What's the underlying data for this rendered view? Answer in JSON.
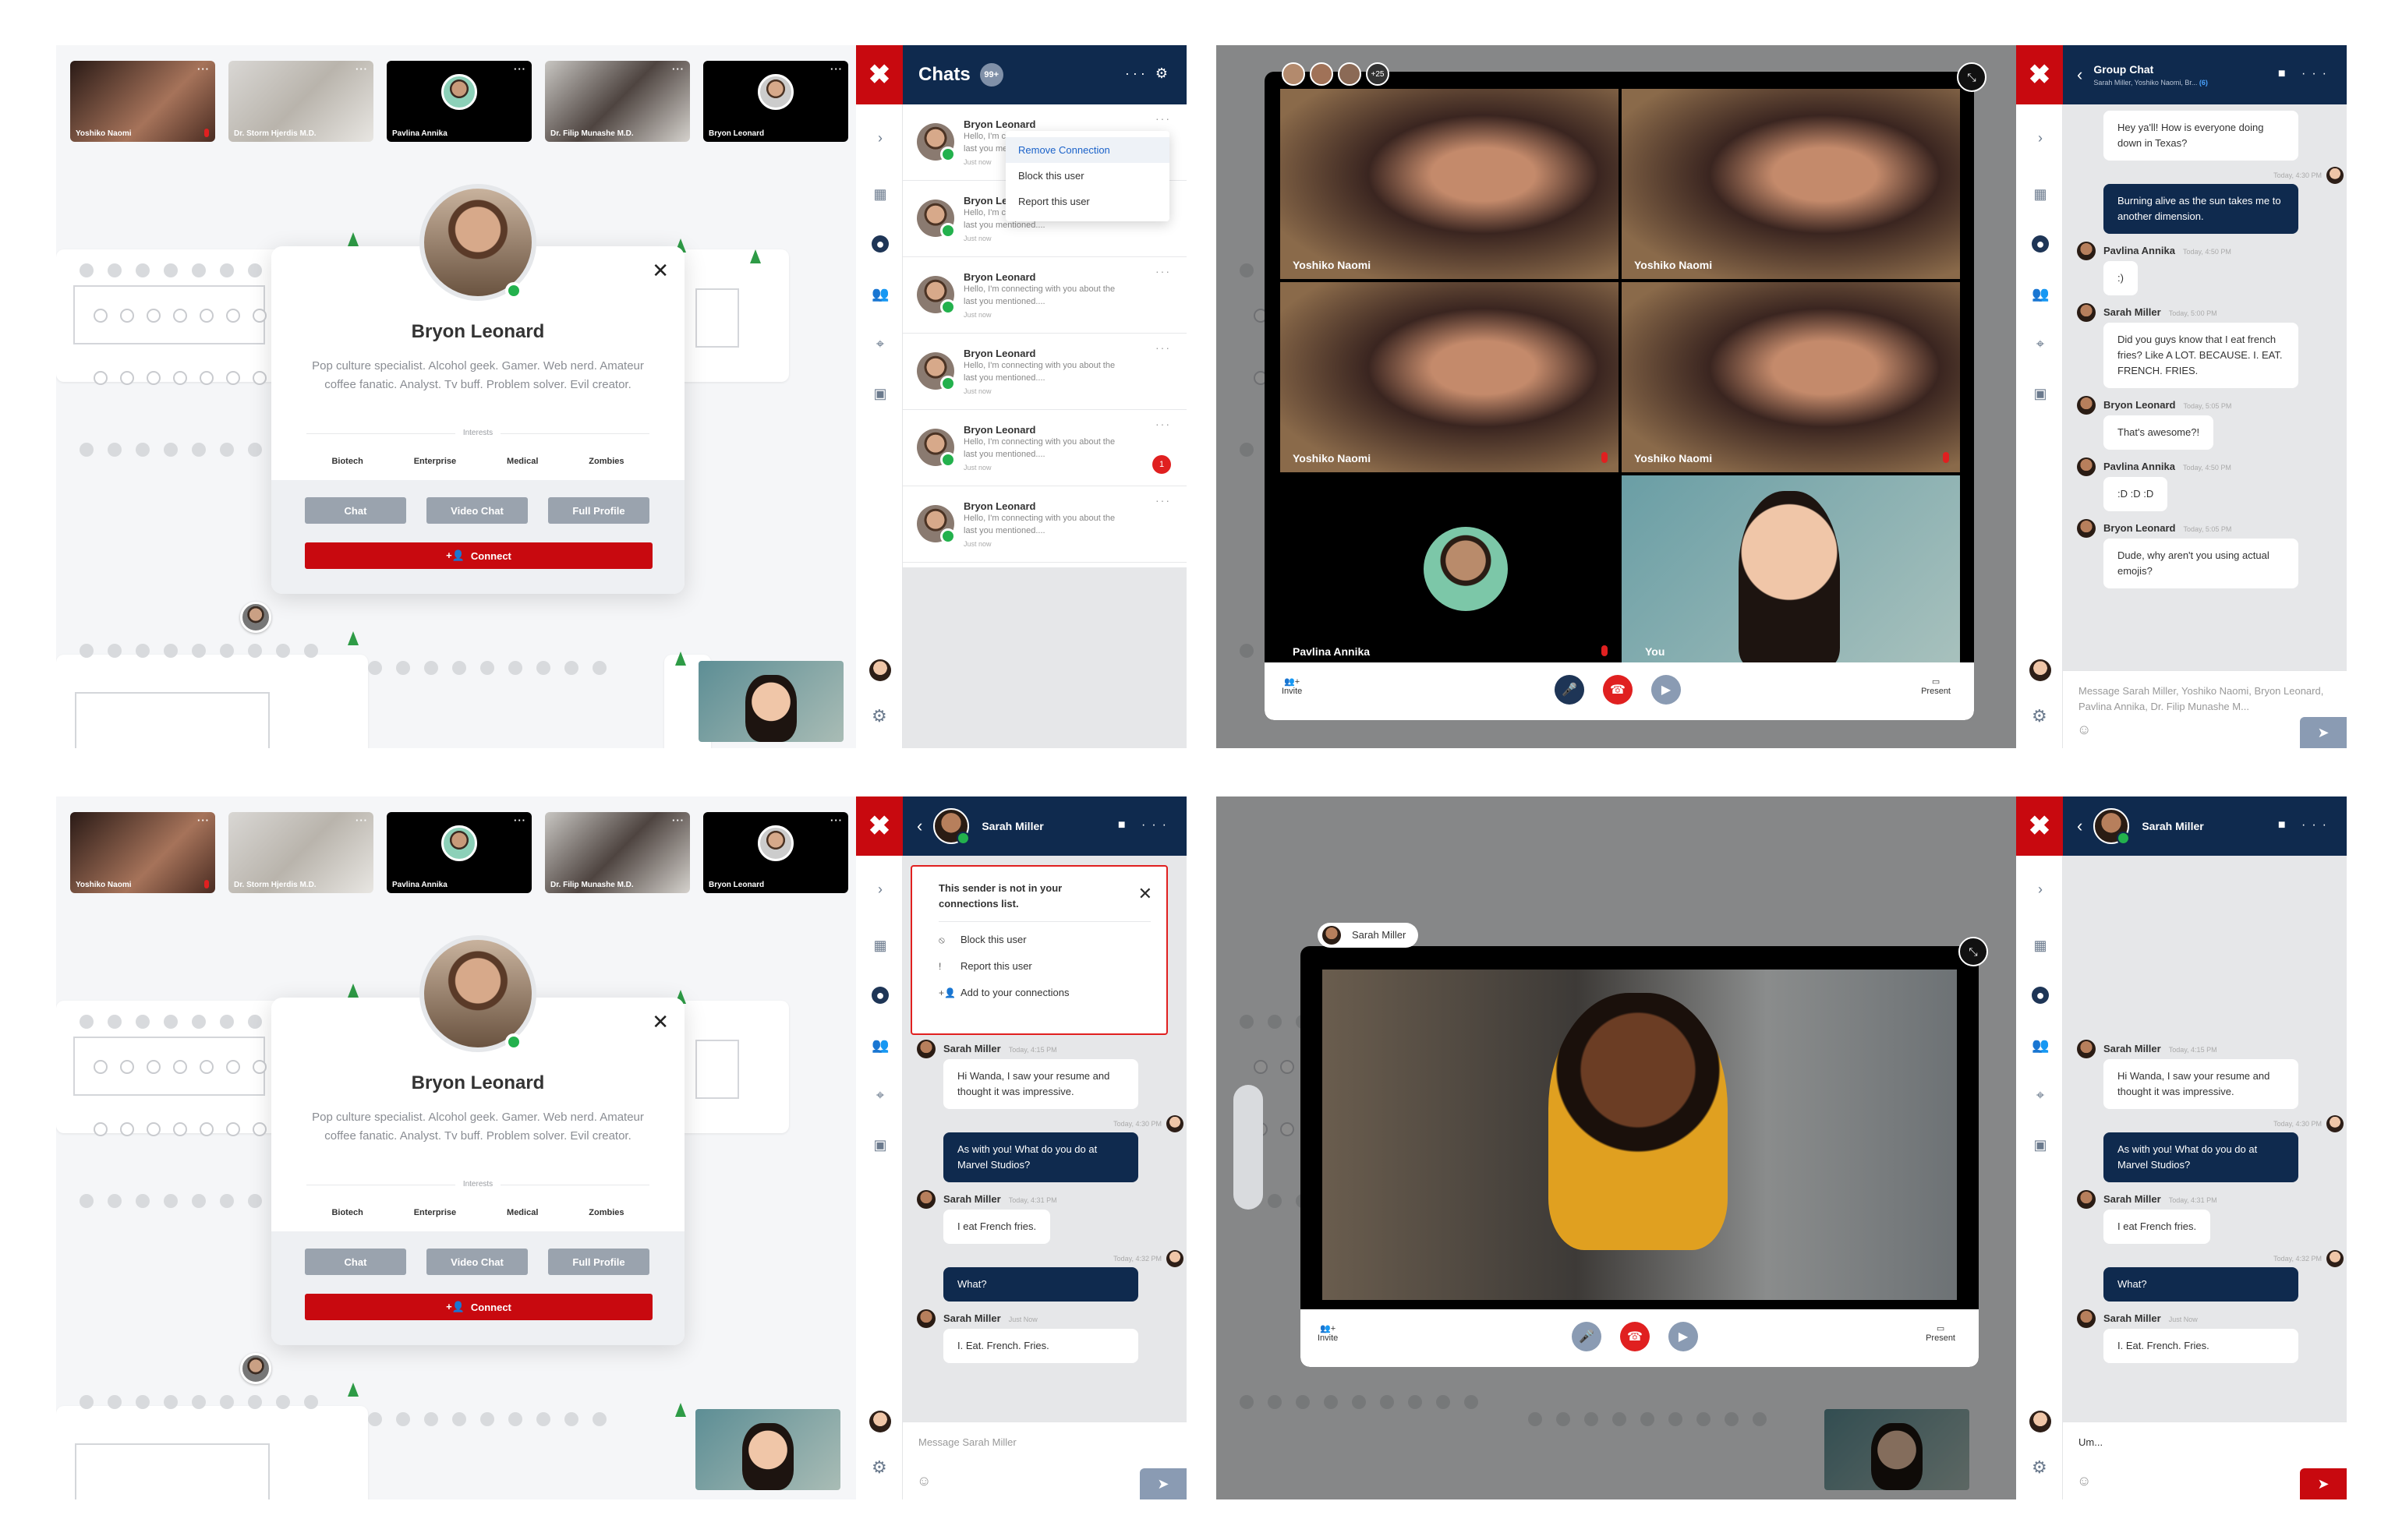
{
  "participants": {
    "tiles": [
      {
        "name": "Yoshiko Naomi",
        "muted": true
      },
      {
        "name": "Dr. Storm Hjerdis M.D.",
        "muted": false
      },
      {
        "name": "Pavlina Annika",
        "muted": false
      },
      {
        "name": "Dr. Filip Munashe M.D.",
        "muted": false
      },
      {
        "name": "Bryon Leonard",
        "muted": false
      }
    ]
  },
  "profile": {
    "name": "Bryon Leonard",
    "bio": "Pop culture specialist. Alcohol geek. Gamer. Web nerd. Amateur coffee fanatic. Analyst. Tv buff. Problem solver. Evil creator.",
    "interests_label": "Interests",
    "interests": [
      "Biotech",
      "Enterprise",
      "Medical",
      "Zombies"
    ],
    "chat_btn": "Chat",
    "video_chat_btn": "Video Chat",
    "full_profile_btn": "Full Profile",
    "connect_btn": "Connect"
  },
  "chats": {
    "title": "Chats",
    "badge": "99+",
    "items": [
      {
        "name": "Bryon Leonard",
        "preview": "Hello, I'm connecting with you about the last you mentioned....",
        "time": "Just now",
        "unread": ""
      },
      {
        "name": "Bryon Leonard",
        "preview": "Hello, I'm connecting with you about the last you mentioned....",
        "time": "Just now",
        "unread": ""
      },
      {
        "name": "Bryon Leonard",
        "preview": "Hello, I'm connecting with you about the last you mentioned....",
        "time": "Just now",
        "unread": ""
      },
      {
        "name": "Bryon Leonard",
        "preview": "Hello, I'm connecting with you about the last you mentioned....",
        "time": "Just now",
        "unread": ""
      },
      {
        "name": "Bryon Leonard",
        "preview": "Hello, I'm connecting with you about the last you mentioned....",
        "time": "Just now",
        "unread": "1"
      },
      {
        "name": "Bryon Leonard",
        "preview": "Hello, I'm connecting with you about the last you mentioned....",
        "time": "Just now",
        "unread": ""
      }
    ],
    "menu": [
      "Remove Connection",
      "Block this user",
      "Report this user"
    ]
  },
  "group_call": {
    "extra_count": "+25",
    "tiles": [
      "Yoshiko Naomi",
      "Yoshiko Naomi",
      "Yoshiko Naomi",
      "Yoshiko Naomi",
      "Pavlina Annika",
      "You"
    ],
    "invite": "Invite",
    "present": "Present"
  },
  "group_chat": {
    "title": "Group Chat",
    "subtitle": "Sarah Miller, Yoshiko Naomi, Br...",
    "subtitle_more": "(6)",
    "messages": [
      {
        "from": "",
        "time": "",
        "text": "Hey ya'll! How is everyone doing down in Texas?",
        "me": false
      },
      {
        "from": "",
        "time": "Today, 4:30 PM",
        "text": "Burning alive as the sun takes me to another dimension.",
        "me": true
      },
      {
        "from": "Pavlina Annika",
        "time": "Today, 4:50 PM",
        "text": ":)",
        "me": false
      },
      {
        "from": "Sarah Miller",
        "time": "Today, 5:00 PM",
        "text": "Did you guys know that I eat french fries? Like A LOT. BECAUSE. I. EAT. FRENCH. FRIES.",
        "me": false
      },
      {
        "from": "Bryon Leonard",
        "time": "Today, 5:05 PM",
        "text": "That's awesome?!",
        "me": false
      },
      {
        "from": "Pavlina Annika",
        "time": "Today, 4:50 PM",
        "text": ":D :D :D",
        "me": false
      },
      {
        "from": "Bryon Leonard",
        "time": "Today, 5:05 PM",
        "text": "Dude, why aren't you using actual emojis?",
        "me": false
      }
    ],
    "composer_placeholder": "Message Sarah Miller, Yoshiko Naomi, Bryon Leonard, Pavlina Annika, Dr. Filip Munashe M..."
  },
  "dm": {
    "title": "Sarah Miller",
    "notice_title": "This sender is not in your connections list.",
    "notice_options": [
      "Block this user",
      "Report this user",
      "Add to your connections"
    ],
    "messages": [
      {
        "from": "Sarah Miller",
        "time": "Today, 4:15 PM",
        "text": "Hi Wanda, I saw your resume and thought it was impressive.",
        "me": false
      },
      {
        "from": "",
        "time": "Today, 4:30 PM",
        "text": "As with you! What do you do at Marvel Studios?",
        "me": true
      },
      {
        "from": "Sarah Miller",
        "time": "Today, 4:31 PM",
        "text": "I eat French fries.",
        "me": false
      },
      {
        "from": "",
        "time": "Today, 4:32 PM",
        "text": "What?",
        "me": true
      },
      {
        "from": "Sarah Miller",
        "time": "Just Now",
        "text": "I. Eat. French. Fries.",
        "me": false
      }
    ],
    "composer_placeholder": "Message Sarah Miller",
    "composer_value": "Um..."
  },
  "one_call": {
    "name": "Sarah Miller",
    "invite": "Invite",
    "present": "Present"
  },
  "colors": {
    "brand_red": "#c8090f",
    "navy": "#0f2a4e",
    "online": "#23b14d"
  }
}
